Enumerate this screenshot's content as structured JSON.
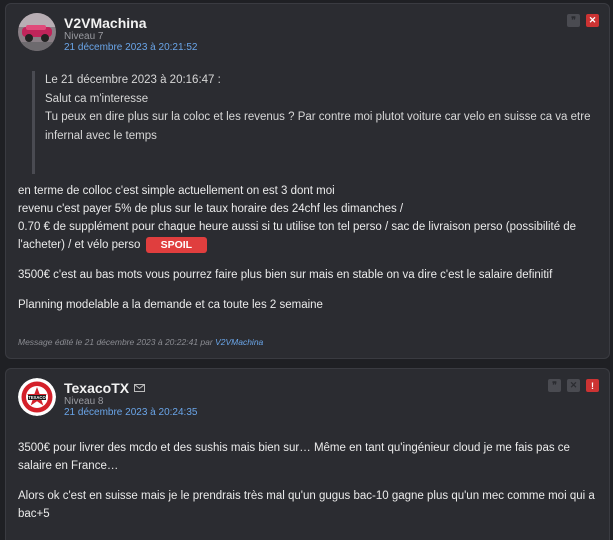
{
  "posts": [
    {
      "pseudo": "V2VMachina",
      "niveau": "Niveau 7",
      "date": "21 décembre 2023 à 20:21:52",
      "quote": {
        "line1": "Le 21 décembre 2023 à 20:16:47 :",
        "line2": "Salut ca m'interesse",
        "line3": "Tu peux en dire plus sur la coloc et les revenus ? Par contre moi plutot voiture car velo en suisse ca va etre infernal avec le temps"
      },
      "body": {
        "p1_l1": "en terme de colloc c'est simple actuellement on est 3 dont moi",
        "p1_l2": "revenu c'est payer 5% de plus sur le taux horaire des 24chf les dimanches /",
        "p1_l3": "0.70 € de supplément pour chaque heure aussi si tu utilise ton tel perso / sac de livraison perso (possibilité de l'acheter) / et vélo perso",
        "spoil": "SPOIL",
        "p2": "3500€ c'est au bas mots vous pourrez faire plus bien sur mais en stable on va dire c'est le salaire definitif",
        "p3": "Planning modelable a la demande et ca toute les 2 semaine"
      },
      "edited": {
        "prefix": "Message édité le 21 décembre 2023 à 20:22:41 par",
        "author": "V2VMachina"
      }
    },
    {
      "pseudo": "TexacoTX",
      "niveau": "Niveau 8",
      "date": "21 décembre 2023 à 20:24:35",
      "body": {
        "p1": "3500€ pour livrer des mcdo et des sushis mais bien sur… Même en tant qu'ingénieur cloud je me fais pas ce salaire en France…",
        "p2": "Alors ok c'est en suisse mais je le prendrais très mal qu'un gugus bac-10 gagne plus qu'un mec comme moi qui a bac+5"
      },
      "avatar_text": "TEXACO"
    }
  ],
  "icons": {
    "quote": "quote-icon",
    "report": "report-icon",
    "mp": "mail-icon",
    "block": "block-icon",
    "alert": "alert-icon"
  },
  "colors": {
    "link": "#6aa5e8",
    "spoil": "#e03e3e",
    "background": "#1f2024",
    "card": "#2b2c31"
  }
}
